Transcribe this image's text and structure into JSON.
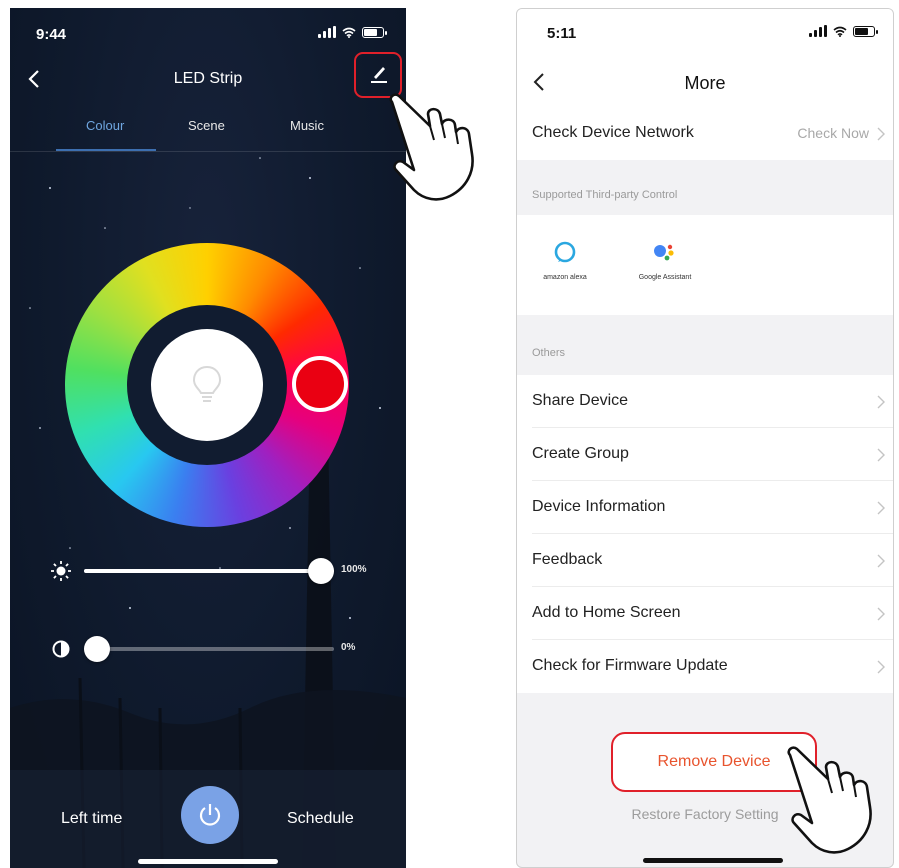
{
  "left_screen": {
    "status": {
      "time": "9:44"
    },
    "nav": {
      "title": "LED Strip"
    },
    "tabs": [
      {
        "label": "Colour",
        "active": true
      },
      {
        "label": "Scene",
        "active": false
      },
      {
        "label": "Music",
        "active": false
      }
    ],
    "colour_wheel": {
      "selected_color": "#ea0012"
    },
    "brightness": {
      "value": "100%",
      "level": 1.0
    },
    "contrast": {
      "value": "0%",
      "level": 0.0
    },
    "bottom": {
      "left_time_label": "Left time",
      "schedule_label": "Schedule"
    },
    "colors": {
      "background": "#0f1a2d",
      "accent": "#6fa6e0",
      "power_button": "#7aa2e6",
      "highlight": "#e0202a"
    }
  },
  "right_screen": {
    "status": {
      "time": "5:11"
    },
    "nav": {
      "title": "More"
    },
    "network_row": {
      "label": "Check Device Network",
      "value": "Check Now"
    },
    "third_party": {
      "heading": "Supported Third-party Control",
      "items": [
        {
          "label": "amazon alexa",
          "icon": "alexa-icon"
        },
        {
          "label": "Google Assistant",
          "icon": "google-assistant-icon"
        }
      ]
    },
    "others": {
      "heading": "Others",
      "items": [
        {
          "label": "Share Device"
        },
        {
          "label": "Create Group"
        },
        {
          "label": "Device Information"
        },
        {
          "label": "Feedback"
        },
        {
          "label": "Add to Home Screen"
        },
        {
          "label": "Check for Firmware Update"
        }
      ]
    },
    "remove_device": "Remove Device",
    "restore_factory": "Restore Factory Setting",
    "colors": {
      "remove_text": "#e8542e",
      "highlight": "#e0202a"
    }
  }
}
